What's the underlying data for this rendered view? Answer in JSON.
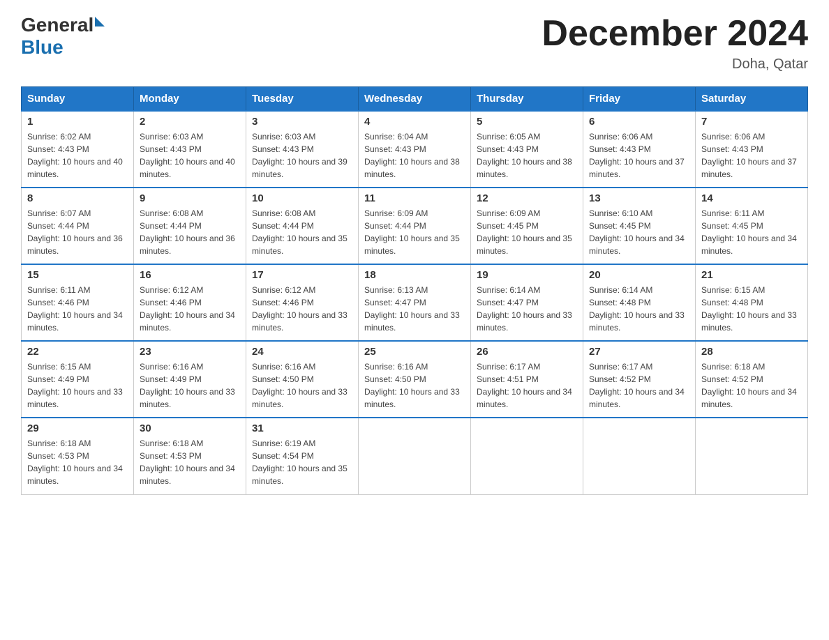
{
  "header": {
    "logo_general": "General",
    "logo_blue": "Blue",
    "month_title": "December 2024",
    "location": "Doha, Qatar"
  },
  "days_of_week": [
    "Sunday",
    "Monday",
    "Tuesday",
    "Wednesday",
    "Thursday",
    "Friday",
    "Saturday"
  ],
  "weeks": [
    [
      {
        "day": "1",
        "sunrise": "6:02 AM",
        "sunset": "4:43 PM",
        "daylight": "10 hours and 40 minutes."
      },
      {
        "day": "2",
        "sunrise": "6:03 AM",
        "sunset": "4:43 PM",
        "daylight": "10 hours and 40 minutes."
      },
      {
        "day": "3",
        "sunrise": "6:03 AM",
        "sunset": "4:43 PM",
        "daylight": "10 hours and 39 minutes."
      },
      {
        "day": "4",
        "sunrise": "6:04 AM",
        "sunset": "4:43 PM",
        "daylight": "10 hours and 38 minutes."
      },
      {
        "day": "5",
        "sunrise": "6:05 AM",
        "sunset": "4:43 PM",
        "daylight": "10 hours and 38 minutes."
      },
      {
        "day": "6",
        "sunrise": "6:06 AM",
        "sunset": "4:43 PM",
        "daylight": "10 hours and 37 minutes."
      },
      {
        "day": "7",
        "sunrise": "6:06 AM",
        "sunset": "4:43 PM",
        "daylight": "10 hours and 37 minutes."
      }
    ],
    [
      {
        "day": "8",
        "sunrise": "6:07 AM",
        "sunset": "4:44 PM",
        "daylight": "10 hours and 36 minutes."
      },
      {
        "day": "9",
        "sunrise": "6:08 AM",
        "sunset": "4:44 PM",
        "daylight": "10 hours and 36 minutes."
      },
      {
        "day": "10",
        "sunrise": "6:08 AM",
        "sunset": "4:44 PM",
        "daylight": "10 hours and 35 minutes."
      },
      {
        "day": "11",
        "sunrise": "6:09 AM",
        "sunset": "4:44 PM",
        "daylight": "10 hours and 35 minutes."
      },
      {
        "day": "12",
        "sunrise": "6:09 AM",
        "sunset": "4:45 PM",
        "daylight": "10 hours and 35 minutes."
      },
      {
        "day": "13",
        "sunrise": "6:10 AM",
        "sunset": "4:45 PM",
        "daylight": "10 hours and 34 minutes."
      },
      {
        "day": "14",
        "sunrise": "6:11 AM",
        "sunset": "4:45 PM",
        "daylight": "10 hours and 34 minutes."
      }
    ],
    [
      {
        "day": "15",
        "sunrise": "6:11 AM",
        "sunset": "4:46 PM",
        "daylight": "10 hours and 34 minutes."
      },
      {
        "day": "16",
        "sunrise": "6:12 AM",
        "sunset": "4:46 PM",
        "daylight": "10 hours and 34 minutes."
      },
      {
        "day": "17",
        "sunrise": "6:12 AM",
        "sunset": "4:46 PM",
        "daylight": "10 hours and 33 minutes."
      },
      {
        "day": "18",
        "sunrise": "6:13 AM",
        "sunset": "4:47 PM",
        "daylight": "10 hours and 33 minutes."
      },
      {
        "day": "19",
        "sunrise": "6:14 AM",
        "sunset": "4:47 PM",
        "daylight": "10 hours and 33 minutes."
      },
      {
        "day": "20",
        "sunrise": "6:14 AM",
        "sunset": "4:48 PM",
        "daylight": "10 hours and 33 minutes."
      },
      {
        "day": "21",
        "sunrise": "6:15 AM",
        "sunset": "4:48 PM",
        "daylight": "10 hours and 33 minutes."
      }
    ],
    [
      {
        "day": "22",
        "sunrise": "6:15 AM",
        "sunset": "4:49 PM",
        "daylight": "10 hours and 33 minutes."
      },
      {
        "day": "23",
        "sunrise": "6:16 AM",
        "sunset": "4:49 PM",
        "daylight": "10 hours and 33 minutes."
      },
      {
        "day": "24",
        "sunrise": "6:16 AM",
        "sunset": "4:50 PM",
        "daylight": "10 hours and 33 minutes."
      },
      {
        "day": "25",
        "sunrise": "6:16 AM",
        "sunset": "4:50 PM",
        "daylight": "10 hours and 33 minutes."
      },
      {
        "day": "26",
        "sunrise": "6:17 AM",
        "sunset": "4:51 PM",
        "daylight": "10 hours and 34 minutes."
      },
      {
        "day": "27",
        "sunrise": "6:17 AM",
        "sunset": "4:52 PM",
        "daylight": "10 hours and 34 minutes."
      },
      {
        "day": "28",
        "sunrise": "6:18 AM",
        "sunset": "4:52 PM",
        "daylight": "10 hours and 34 minutes."
      }
    ],
    [
      {
        "day": "29",
        "sunrise": "6:18 AM",
        "sunset": "4:53 PM",
        "daylight": "10 hours and 34 minutes."
      },
      {
        "day": "30",
        "sunrise": "6:18 AM",
        "sunset": "4:53 PM",
        "daylight": "10 hours and 34 minutes."
      },
      {
        "day": "31",
        "sunrise": "6:19 AM",
        "sunset": "4:54 PM",
        "daylight": "10 hours and 35 minutes."
      },
      null,
      null,
      null,
      null
    ]
  ]
}
